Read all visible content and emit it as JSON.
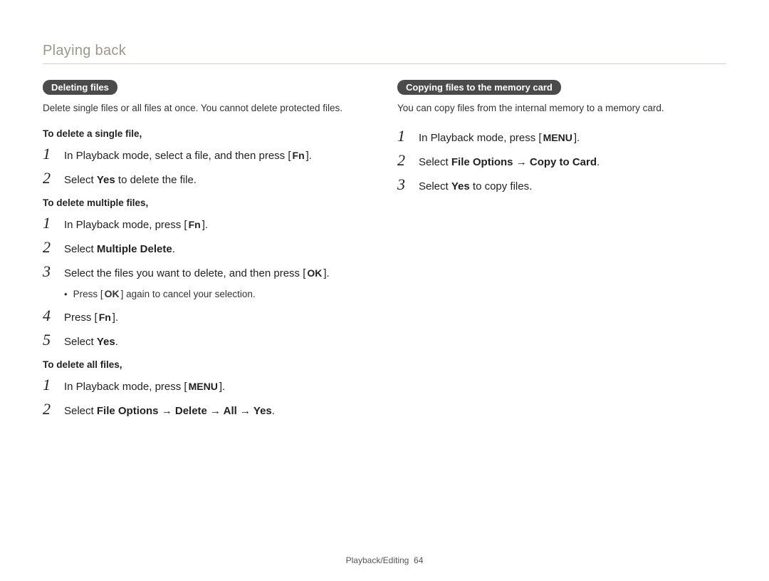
{
  "section_title": "Playing back",
  "left": {
    "pill": "Deleting files",
    "intro": "Delete single files or all files at once. You cannot delete protected files.",
    "heading_single": "To delete a single file,",
    "single_steps": [
      {
        "num": "1",
        "pre": "In Playback mode, select a file, and then press [",
        "key": "Fn",
        "post": "]."
      },
      {
        "num": "2",
        "pre": "Select ",
        "bold": "Yes",
        "post": " to delete the file."
      }
    ],
    "heading_multiple": "To delete multiple files,",
    "multi": {
      "s1": {
        "num": "1",
        "pre": "In Playback mode, press [",
        "key": "Fn",
        "post": "]."
      },
      "s2": {
        "num": "2",
        "pre": "Select ",
        "bold": "Multiple Delete",
        "post": "."
      },
      "s3": {
        "num": "3",
        "pre": "Select the files you want to delete, and then press [",
        "key": "OK",
        "post": "]."
      },
      "s3_bullet": {
        "pre": "Press [",
        "key": "OK",
        "post": "] again to cancel your selection."
      },
      "s4": {
        "num": "4",
        "pre": "Press [",
        "key": "Fn",
        "post": "]."
      },
      "s5": {
        "num": "5",
        "pre": "Select ",
        "bold": "Yes",
        "post": "."
      }
    },
    "heading_all": "To delete all files,",
    "all": {
      "s1": {
        "num": "1",
        "pre": "In Playback mode, press [",
        "key": "MENU",
        "post": "]."
      },
      "s2": {
        "num": "2",
        "pre": "Select ",
        "bold": "File Options → Delete → All → Yes",
        "post": "."
      }
    }
  },
  "right": {
    "pill": "Copying files to the memory card",
    "intro": "You can copy files from the internal memory to a memory card.",
    "s1": {
      "num": "1",
      "pre": "In Playback mode, press [",
      "key": "MENU",
      "post": "]."
    },
    "s2": {
      "num": "2",
      "pre": "Select ",
      "bold": "File Options → Copy to Card",
      "post": "."
    },
    "s3": {
      "num": "3",
      "pre": "Select ",
      "bold": "Yes",
      "post": " to copy files."
    }
  },
  "footer": {
    "label": "Playback/Editing",
    "page": "64"
  }
}
